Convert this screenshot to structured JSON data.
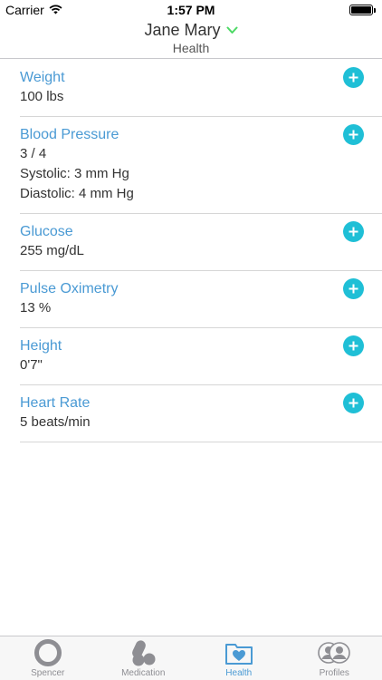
{
  "status_bar": {
    "carrier": "Carrier",
    "time": "1:57 PM"
  },
  "header": {
    "title": "Jane Mary",
    "subtitle": "Health"
  },
  "metrics": [
    {
      "label": "Weight",
      "values": [
        "100 lbs"
      ]
    },
    {
      "label": "Blood Pressure",
      "values": [
        "3 / 4",
        "Systolic: 3 mm Hg",
        "Diastolic: 4 mm Hg"
      ]
    },
    {
      "label": "Glucose",
      "values": [
        "255 mg/dL"
      ]
    },
    {
      "label": "Pulse Oximetry",
      "values": [
        "13 %"
      ]
    },
    {
      "label": "Height",
      "values": [
        "0'7\""
      ]
    },
    {
      "label": "Heart Rate",
      "values": [
        "5 beats/min"
      ]
    }
  ],
  "tabs": [
    {
      "label": "Spencer",
      "icon": "ring-icon"
    },
    {
      "label": "Medication",
      "icon": "pills-icon"
    },
    {
      "label": "Health",
      "icon": "heart-folder-icon",
      "active": true
    },
    {
      "label": "Profiles",
      "icon": "profiles-icon"
    }
  ],
  "colors": {
    "accent": "#4a9ad4",
    "add_button": "#1fbfd6",
    "chevron": "#4cd964"
  }
}
